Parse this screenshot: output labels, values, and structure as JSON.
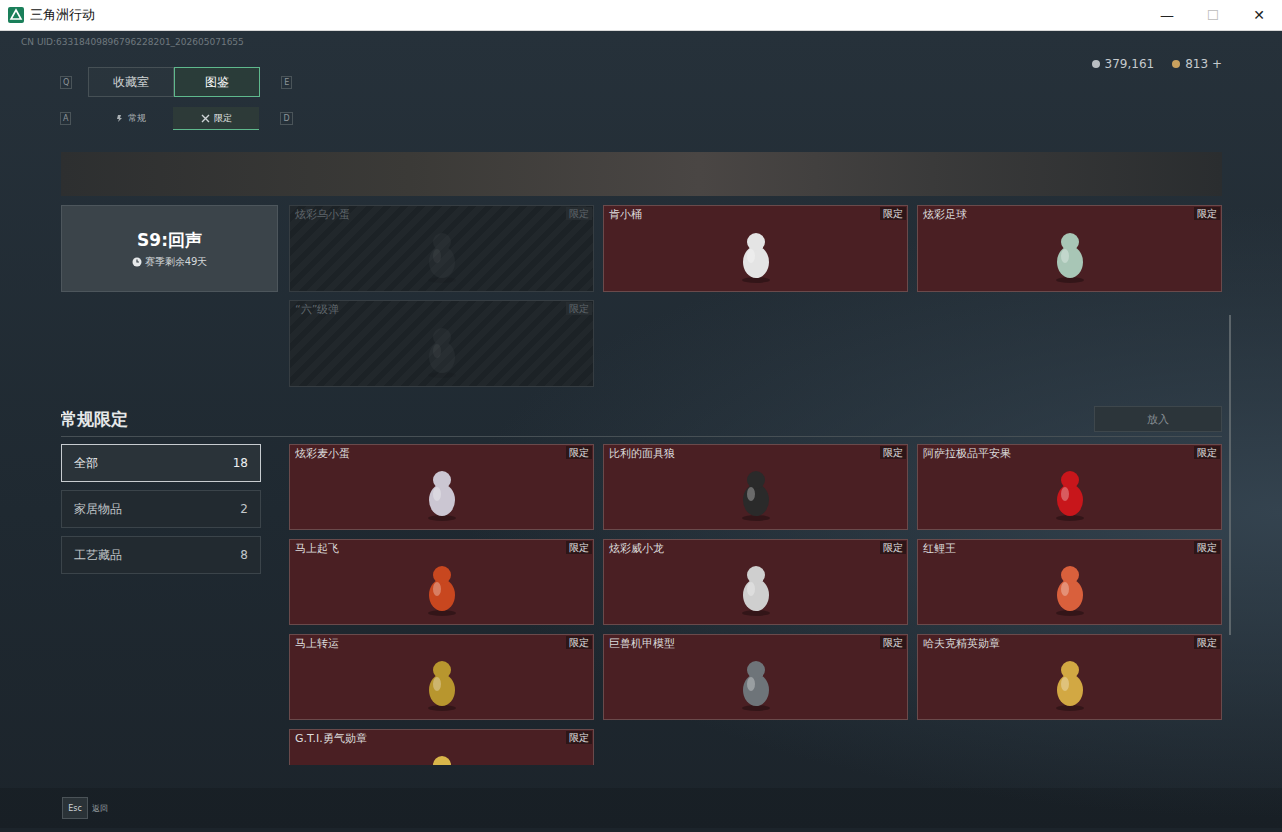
{
  "window": {
    "title": "三角洲行动",
    "controls": [
      {
        "glyph": "—",
        "disabled": false
      },
      {
        "glyph": "☐",
        "disabled": true
      },
      {
        "glyph": "✕",
        "disabled": false
      }
    ]
  },
  "uid": "CN UID:63318409896796228201_202605071655",
  "currency": [
    {
      "amount": "379,161",
      "color": "#b9bec2"
    },
    {
      "amount": "813 +",
      "color": "#c9a15e"
    }
  ],
  "tabs": {
    "prev_key": "Q",
    "next_key": "E",
    "items": [
      {
        "label": "收藏室",
        "selected": false
      },
      {
        "label": "图鉴",
        "selected": true
      }
    ]
  },
  "subtabs": {
    "prev_key": "A",
    "next_key": "D",
    "items": [
      {
        "label": "常规",
        "selected": false
      },
      {
        "label": "限定",
        "selected": true
      }
    ]
  },
  "season": {
    "title": "S9:回声",
    "remaining": "赛季剩余49天",
    "items": [
      {
        "name": "炫彩乌小蛋",
        "badge": "限定",
        "owned": false,
        "color": "#4a5054"
      },
      {
        "name": "肯小桶",
        "badge": "限定",
        "owned": true,
        "color": "#e4e4e4"
      },
      {
        "name": "炫彩足球",
        "badge": "限定",
        "owned": true,
        "color": "#a8c6b6"
      },
      {
        "name": "“六”级弹",
        "badge": "限定",
        "owned": false,
        "color": "#4a5054"
      }
    ]
  },
  "section": {
    "title": "常规限定",
    "button": {
      "label": "放入",
      "disabled": true
    },
    "filters": [
      {
        "label": "全部",
        "count": "18",
        "selected": true
      },
      {
        "label": "家居物品",
        "count": "2",
        "selected": false
      },
      {
        "label": "工艺藏品",
        "count": "8",
        "selected": false
      }
    ],
    "items": [
      {
        "name": "炫彩麦小蛋",
        "badge": "限定",
        "owned": true,
        "color": "#cbc6d2"
      },
      {
        "name": "比利的面具狼",
        "badge": "限定",
        "owned": true,
        "color": "#2a2a2a"
      },
      {
        "name": "阿萨拉极品平安果",
        "badge": "限定",
        "owned": true,
        "color": "#c8161b"
      },
      {
        "name": "马上起飞",
        "badge": "限定",
        "owned": true,
        "color": "#c8471f"
      },
      {
        "name": "炫彩威小龙",
        "badge": "限定",
        "owned": true,
        "color": "#cfcfcf"
      },
      {
        "name": "红鲤王",
        "badge": "限定",
        "owned": true,
        "color": "#d9603c"
      },
      {
        "name": "马上转运",
        "badge": "限定",
        "owned": true,
        "color": "#b8962e"
      },
      {
        "name": "巨兽机甲模型",
        "badge": "限定",
        "owned": true,
        "color": "#6e7479"
      },
      {
        "name": "哈夫克精英勋章",
        "badge": "限定",
        "owned": true,
        "color": "#d2a843"
      },
      {
        "name": "G.T.I.勇气勋章",
        "badge": "限定",
        "owned": true,
        "color": "#d9b64a"
      }
    ]
  },
  "footer": {
    "key": "Esc",
    "label": "返回"
  }
}
